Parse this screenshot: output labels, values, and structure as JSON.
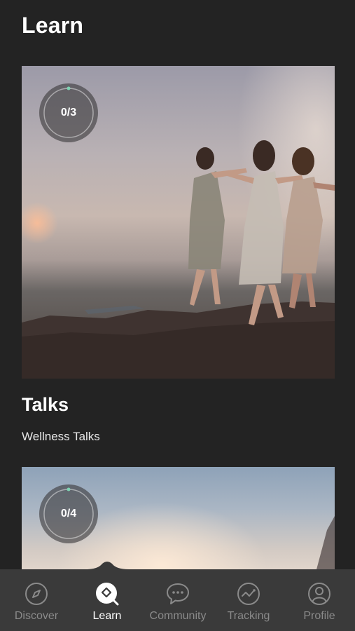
{
  "header": {
    "title": "Learn"
  },
  "cards": [
    {
      "progress": "0/3",
      "progress_fraction": 0,
      "title": "Talks",
      "subtitle": "Wellness Talks"
    },
    {
      "progress": "0/4",
      "progress_fraction": 0
    }
  ],
  "tabbar": {
    "items": [
      {
        "label": "Discover",
        "icon": "compass-icon",
        "active": false
      },
      {
        "label": "Learn",
        "icon": "learn-search-icon",
        "active": true
      },
      {
        "label": "Community",
        "icon": "chat-bubble-icon",
        "active": false
      },
      {
        "label": "Tracking",
        "icon": "tracking-chart-icon",
        "active": false
      },
      {
        "label": "Profile",
        "icon": "person-icon",
        "active": false
      }
    ]
  },
  "colors": {
    "background": "#232323",
    "tabbar": "#3a3a3a",
    "ring_accent": "#7ed3b2",
    "inactive_tab": "#8a8a8a"
  }
}
